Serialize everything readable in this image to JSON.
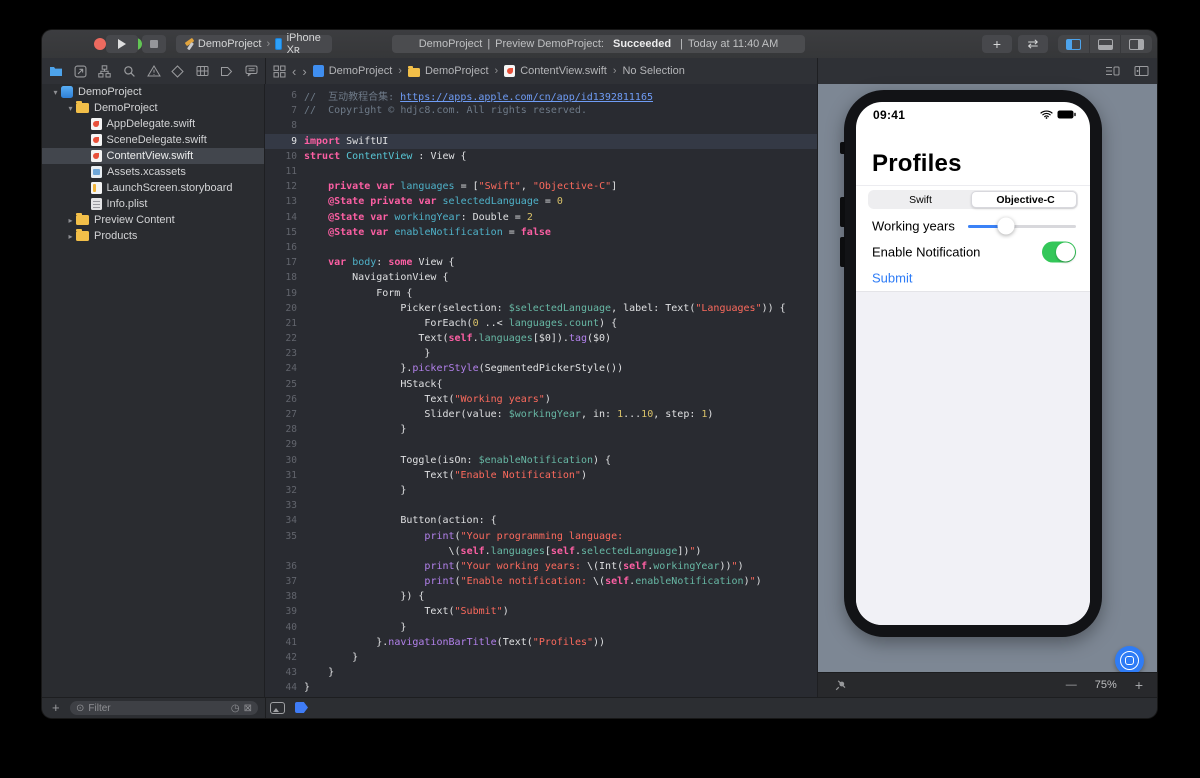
{
  "toolbar": {
    "scheme": {
      "app": "DemoProject",
      "device": "iPhone Xʀ"
    },
    "status": {
      "project": "DemoProject",
      "sep": "|",
      "message": "Preview DemoProject:",
      "result": "Succeeded",
      "time": "Today at 11:40 AM"
    }
  },
  "icons": {
    "add": "+",
    "swap": "⇄",
    "chevron_left": "‹",
    "chevron_right": "›",
    "crumb_sep": "›",
    "zoom_out": "—",
    "zoom_in": "+",
    "filter": "⊙",
    "clock": "◷",
    "clear": "⊠",
    "disclosure_open": "▾",
    "disclosure_closed": "▸"
  },
  "jumpbar": {
    "items": [
      {
        "label": "DemoProject",
        "icon": "project"
      },
      {
        "label": "DemoProject",
        "icon": "folder"
      },
      {
        "label": "ContentView.swift",
        "icon": "swift"
      },
      {
        "label": "No Selection",
        "icon": ""
      }
    ]
  },
  "sidebar": {
    "filter_placeholder": "Filter",
    "tree": [
      {
        "label": "DemoProject",
        "icon": "project",
        "depth": 0,
        "disclosure": "open"
      },
      {
        "label": "DemoProject",
        "icon": "folder",
        "depth": 1,
        "disclosure": "open"
      },
      {
        "label": "AppDelegate.swift",
        "icon": "swift",
        "depth": 2
      },
      {
        "label": "SceneDelegate.swift",
        "icon": "swift",
        "depth": 2
      },
      {
        "label": "ContentView.swift",
        "icon": "swift",
        "depth": 2,
        "selected": true
      },
      {
        "label": "Assets.xcassets",
        "icon": "assets",
        "depth": 2
      },
      {
        "label": "LaunchScreen.storyboard",
        "icon": "storyboard",
        "depth": 2
      },
      {
        "label": "Info.plist",
        "icon": "plist",
        "depth": 2
      },
      {
        "label": "Preview Content",
        "icon": "folder",
        "depth": 1,
        "disclosure": "closed"
      },
      {
        "label": "Products",
        "icon": "folder",
        "depth": 1,
        "disclosure": "closed"
      }
    ]
  },
  "editor": {
    "lines": [
      {
        "n": "6",
        "tok": [
          [
            "cm",
            "//  互动教程合集: "
          ],
          [
            "url",
            "https://apps.apple.com/cn/app/id1392811165"
          ]
        ]
      },
      {
        "n": "7",
        "tok": [
          [
            "cm",
            "//  Copyright © hdjc8.com. All rights reserved."
          ]
        ]
      },
      {
        "n": "8",
        "tok": []
      },
      {
        "n": "9",
        "hl": true,
        "tok": [
          [
            "kw",
            "import"
          ],
          [
            "pl",
            " SwiftUI"
          ]
        ]
      },
      {
        "n": "10",
        "tok": [
          [
            "kw",
            "struct"
          ],
          [
            "pl",
            " "
          ],
          [
            "ty",
            "ContentView"
          ],
          [
            "pl",
            " : View {"
          ]
        ]
      },
      {
        "n": "11",
        "tok": []
      },
      {
        "n": "12",
        "tok": [
          [
            "pl",
            "    "
          ],
          [
            "kw",
            "private"
          ],
          [
            "pl",
            " "
          ],
          [
            "kw",
            "var"
          ],
          [
            "pl",
            " "
          ],
          [
            "dc",
            "languages"
          ],
          [
            "pl",
            " = ["
          ],
          [
            "str",
            "\"Swift\""
          ],
          [
            "pl",
            ", "
          ],
          [
            "str",
            "\"Objective-C\""
          ],
          [
            "pl",
            "]"
          ]
        ]
      },
      {
        "n": "13",
        "tok": [
          [
            "pl",
            "    "
          ],
          [
            "kw",
            "@State"
          ],
          [
            "pl",
            " "
          ],
          [
            "kw",
            "private"
          ],
          [
            "pl",
            " "
          ],
          [
            "kw",
            "var"
          ],
          [
            "pl",
            " "
          ],
          [
            "dc",
            "selectedLanguage"
          ],
          [
            "pl",
            " = "
          ],
          [
            "num",
            "0"
          ]
        ]
      },
      {
        "n": "14",
        "tok": [
          [
            "pl",
            "    "
          ],
          [
            "kw",
            "@State"
          ],
          [
            "pl",
            " "
          ],
          [
            "kw",
            "var"
          ],
          [
            "pl",
            " "
          ],
          [
            "dc",
            "workingYear"
          ],
          [
            "pl",
            ": Double = "
          ],
          [
            "num",
            "2"
          ]
        ]
      },
      {
        "n": "15",
        "tok": [
          [
            "pl",
            "    "
          ],
          [
            "kw",
            "@State"
          ],
          [
            "pl",
            " "
          ],
          [
            "kw",
            "var"
          ],
          [
            "pl",
            " "
          ],
          [
            "dc",
            "enableNotification"
          ],
          [
            "pl",
            " = "
          ],
          [
            "kw",
            "false"
          ]
        ]
      },
      {
        "n": "16",
        "tok": []
      },
      {
        "n": "17",
        "tok": [
          [
            "pl",
            "    "
          ],
          [
            "kw",
            "var"
          ],
          [
            "pl",
            " "
          ],
          [
            "dc",
            "body"
          ],
          [
            "pl",
            ": "
          ],
          [
            "kw",
            "some"
          ],
          [
            "pl",
            " View {"
          ]
        ]
      },
      {
        "n": "18",
        "tok": [
          [
            "pl",
            "        NavigationView {"
          ]
        ]
      },
      {
        "n": "19",
        "tok": [
          [
            "pl",
            "            Form {"
          ]
        ]
      },
      {
        "n": "20",
        "tok": [
          [
            "pl",
            "                Picker(selection: "
          ],
          [
            "rf",
            "$selectedLanguage"
          ],
          [
            "pl",
            ", label: Text("
          ],
          [
            "str",
            "\"Languages\""
          ],
          [
            "pl",
            ")) {"
          ]
        ]
      },
      {
        "n": "21",
        "tok": [
          [
            "pl",
            "                    ForEach("
          ],
          [
            "num",
            "0"
          ],
          [
            "pl",
            " ..< "
          ],
          [
            "rf",
            "languages.count"
          ],
          [
            "pl",
            ") {"
          ]
        ]
      },
      {
        "n": "22",
        "tok": [
          [
            "pl",
            "                   Text("
          ],
          [
            "kw",
            "self"
          ],
          [
            "pl",
            "."
          ],
          [
            "rf",
            "languages"
          ],
          [
            "pl",
            "[$0])."
          ],
          [
            "fn",
            "tag"
          ],
          [
            "pl",
            "($0)"
          ]
        ]
      },
      {
        "n": "23",
        "tok": [
          [
            "pl",
            "                    }"
          ]
        ]
      },
      {
        "n": "24",
        "tok": [
          [
            "pl",
            "                }."
          ],
          [
            "fn",
            "pickerStyle"
          ],
          [
            "pl",
            "(SegmentedPickerStyle())"
          ]
        ]
      },
      {
        "n": "25",
        "tok": [
          [
            "pl",
            "                HStack{"
          ]
        ]
      },
      {
        "n": "26",
        "tok": [
          [
            "pl",
            "                    Text("
          ],
          [
            "str",
            "\"Working years\""
          ],
          [
            "pl",
            ")"
          ]
        ]
      },
      {
        "n": "27",
        "tok": [
          [
            "pl",
            "                    Slider(value: "
          ],
          [
            "rf",
            "$workingYear"
          ],
          [
            "pl",
            ", in: "
          ],
          [
            "num",
            "1"
          ],
          [
            "pl",
            "..."
          ],
          [
            "num",
            "10"
          ],
          [
            "pl",
            ", step: "
          ],
          [
            "num",
            "1"
          ],
          [
            "pl",
            ")"
          ]
        ]
      },
      {
        "n": "28",
        "tok": [
          [
            "pl",
            "                }"
          ]
        ]
      },
      {
        "n": "29",
        "tok": []
      },
      {
        "n": "30",
        "tok": [
          [
            "pl",
            "                Toggle(isOn: "
          ],
          [
            "rf",
            "$enableNotification"
          ],
          [
            "pl",
            ") {"
          ]
        ]
      },
      {
        "n": "31",
        "tok": [
          [
            "pl",
            "                    Text("
          ],
          [
            "str",
            "\"Enable Notification\""
          ],
          [
            "pl",
            ")"
          ]
        ]
      },
      {
        "n": "32",
        "tok": [
          [
            "pl",
            "                }"
          ]
        ]
      },
      {
        "n": "33",
        "tok": []
      },
      {
        "n": "34",
        "tok": [
          [
            "pl",
            "                Button(action: {"
          ]
        ]
      },
      {
        "n": "35",
        "tok": [
          [
            "pl",
            "                    "
          ],
          [
            "fn",
            "print"
          ],
          [
            "pl",
            "("
          ],
          [
            "str",
            "\"Your programming language:"
          ]
        ]
      },
      {
        "n": "",
        "tok": [
          [
            "pl",
            "                        \\("
          ],
          [
            "kw",
            "self"
          ],
          [
            "pl",
            "."
          ],
          [
            "rf",
            "languages"
          ],
          [
            "pl",
            "["
          ],
          [
            "kw",
            "self"
          ],
          [
            "pl",
            "."
          ],
          [
            "rf",
            "selectedLanguage"
          ],
          [
            "pl",
            "])"
          ],
          [
            "str",
            "\""
          ],
          [
            "pl",
            ")"
          ]
        ]
      },
      {
        "n": "36",
        "tok": [
          [
            "pl",
            "                    "
          ],
          [
            "fn",
            "print"
          ],
          [
            "pl",
            "("
          ],
          [
            "str",
            "\"Your working years: "
          ],
          [
            "pl",
            "\\(Int("
          ],
          [
            "kw",
            "self"
          ],
          [
            "pl",
            "."
          ],
          [
            "rf",
            "workingYear"
          ],
          [
            "pl",
            "))"
          ],
          [
            "str",
            "\""
          ],
          [
            "pl",
            ")"
          ]
        ]
      },
      {
        "n": "37",
        "tok": [
          [
            "pl",
            "                    "
          ],
          [
            "fn",
            "print"
          ],
          [
            "pl",
            "("
          ],
          [
            "str",
            "\"Enable notification: "
          ],
          [
            "pl",
            "\\("
          ],
          [
            "kw",
            "self"
          ],
          [
            "pl",
            "."
          ],
          [
            "rf",
            "enableNotification"
          ],
          [
            "pl",
            ")"
          ],
          [
            "str",
            "\""
          ],
          [
            "pl",
            ")"
          ]
        ]
      },
      {
        "n": "38",
        "tok": [
          [
            "pl",
            "                }) {"
          ]
        ]
      },
      {
        "n": "39",
        "tok": [
          [
            "pl",
            "                    Text("
          ],
          [
            "str",
            "\"Submit\""
          ],
          [
            "pl",
            ")"
          ]
        ]
      },
      {
        "n": "40",
        "tok": [
          [
            "pl",
            "                }"
          ]
        ]
      },
      {
        "n": "41",
        "tok": [
          [
            "pl",
            "            }."
          ],
          [
            "fn",
            "navigationBarTitle"
          ],
          [
            "pl",
            "(Text("
          ],
          [
            "str",
            "\"Profiles\""
          ],
          [
            "pl",
            "))"
          ]
        ]
      },
      {
        "n": "42",
        "tok": [
          [
            "pl",
            "        }"
          ]
        ]
      },
      {
        "n": "43",
        "tok": [
          [
            "pl",
            "    }"
          ]
        ]
      },
      {
        "n": "44",
        "tok": [
          [
            "pl",
            "}"
          ]
        ]
      }
    ]
  },
  "preview": {
    "phone": {
      "time": "09:41",
      "title": "Profiles",
      "segments": [
        "Swift",
        "Objective-C"
      ],
      "selected_segment": 1,
      "slider_label": "Working years",
      "slider_fraction": 0.35,
      "toggle_label": "Enable Notification",
      "toggle_on": true,
      "submit_label": "Submit"
    },
    "preview_button": "Preview",
    "zoom_level": "75%"
  },
  "colors": {
    "accent_blue": "#4da3eb",
    "canvas": "#7d8794",
    "toggle_green": "#34c759",
    "slider_blue": "#3b82f7",
    "link_blue": "#2e7cf6",
    "preview_button_blue": "#0c7bfe",
    "keyword": "#fc5fa3",
    "string": "#fc6a5d",
    "number": "#d9c269",
    "comment": "#6e7a88"
  }
}
